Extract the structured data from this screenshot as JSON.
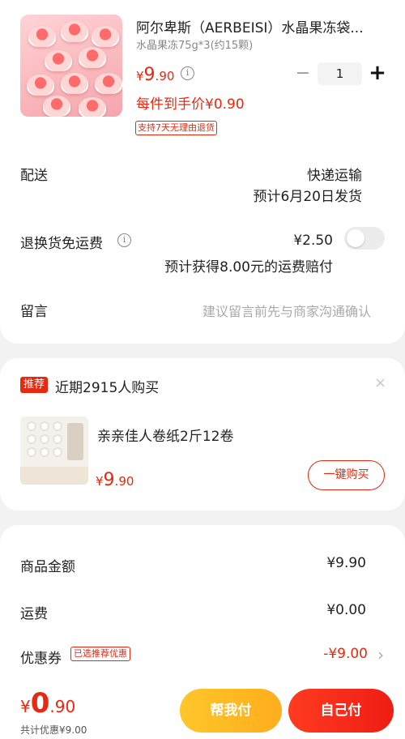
{
  "product": {
    "title": "阿尔卑斯（AERBEISI）水晶果冻袋...",
    "spec": "水晶果冻75g*3(约15颗)",
    "price_currency": "¥",
    "price_int": "9",
    "price_dec": ".90",
    "unit_price": "每件到手价¥0.90",
    "return_tag": "支持7天无理由退货",
    "quantity": "1",
    "minus": "−",
    "plus": "+"
  },
  "shipping": {
    "label": "配送",
    "method": "快递运输",
    "eta": "预计6月20日发货"
  },
  "return_insurance": {
    "label": "退换货免运费",
    "price": "¥2.50",
    "desc": "预计获得8.00元的运费赔付",
    "enabled": false
  },
  "message": {
    "label": "留言",
    "placeholder": "建议留言前先与商家沟通确认"
  },
  "recommend": {
    "badge": "推荐",
    "title": "近期2915人购买",
    "close": "×",
    "item_name": "亲亲佳人卷纸2斤12卷",
    "price_currency": "¥",
    "price_int": "9",
    "price_dec": ".90",
    "button": "一键购买"
  },
  "summary": {
    "goods_label": "商品金额",
    "goods_value": "¥9.90",
    "freight_label": "运费",
    "freight_value": "¥0.00",
    "coupon_label": "优惠券",
    "coupon_tag": "已选推荐优惠",
    "coupon_value": "-¥9.00",
    "chevron": "›"
  },
  "footer": {
    "total_currency": "¥",
    "total_int": "0",
    "total_dec": ".90",
    "discount": "共计优惠¥9.00",
    "help_button": "帮我付",
    "pay_button": "自己付"
  },
  "colors": {
    "accent": "#e8280f",
    "help_button": "#ffb81f"
  }
}
